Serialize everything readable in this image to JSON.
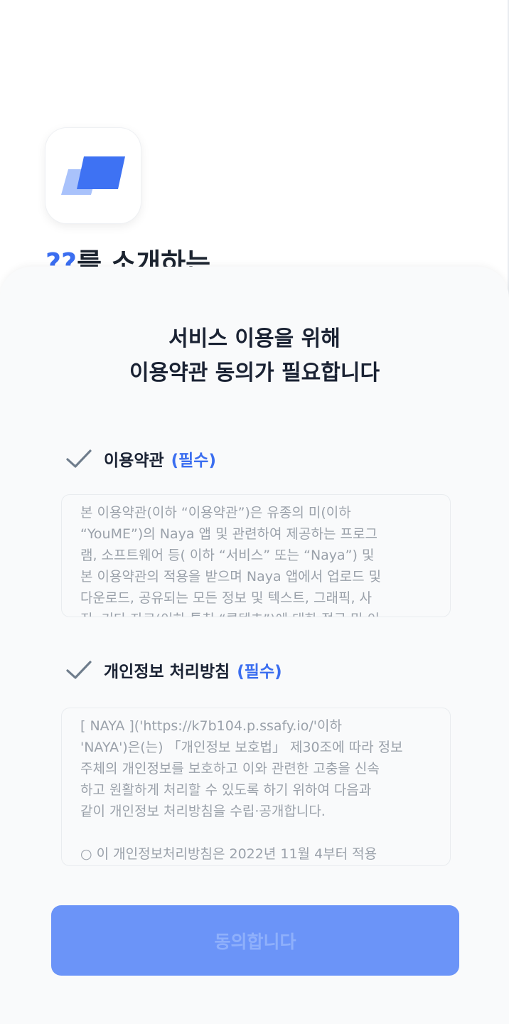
{
  "intro": {
    "title_highlight": "??",
    "title_rest": "를 소개하는"
  },
  "sheet": {
    "title_line1": "서비스 이용을 위해",
    "title_line2": "이용약관 동의가 필요합니다"
  },
  "terms": {
    "label": "이용약관",
    "required": "(필수)",
    "content": "본 이용약관(이하 “이용약관”)은 유종의 미(이하\n“YouME”)의 Naya 앱 및 관련하여 제공하는 프로그\n램, 소프트웨어 등( 이하 “서비스” 또는 “Naya”) 및\n본 이용약관의 적용을 받으며 Naya 앱에서 업로드 및\n다운로드, 공유되는 모든 정보 및 텍스트, 그래픽, 사\n진, 기타 자료(이하 통칭 “콘텐츠”)에 대한 접근 및 이"
  },
  "privacy": {
    "label": "개인정보 처리방침",
    "required": "(필수)",
    "content": "[ NAYA ]('https://k7b104.p.ssafy.io/'이하\n'NAYA')은(는) 「개인정보 보호법」 제30조에 따라 정보\n주체의 개인정보를 보호하고 이와 관련한 고충을 신속\n하고 원활하게 처리할 수 있도록 하기 위하여 다음과\n같이 개인정보 처리방침을 수립·공개합니다.\n\n○ 이 개인정보처리방침은 2022년 11월 4부터 적용"
  },
  "buttons": {
    "agree": "동의합니다"
  },
  "colors": {
    "accent": "#3b6ef0",
    "button_bg": "#6b94f8",
    "check": "#6f7d8c"
  },
  "icons": {
    "logo": "app-logo-icon",
    "check": "check-icon"
  }
}
